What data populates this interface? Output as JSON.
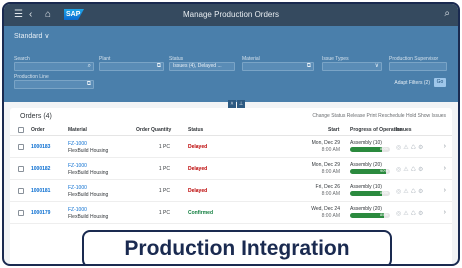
{
  "shell": {
    "title": "Manage Production Orders",
    "logo_text": "SAP"
  },
  "header": {
    "standard_label": "Standard ∨",
    "filters": [
      {
        "label": "Search",
        "value": ""
      },
      {
        "label": "Plant",
        "value": ""
      },
      {
        "label": "Status",
        "value": "Issues (4), Delayed ..."
      },
      {
        "label": "Material",
        "value": ""
      },
      {
        "label": "Issue Types",
        "value": ""
      },
      {
        "label": "Production Supervisor",
        "value": ""
      },
      {
        "label": "Production Line",
        "value": ""
      }
    ],
    "adapt_filters": "Adapt Filters (2)",
    "go": "Go"
  },
  "table": {
    "title": "Orders (4)",
    "toolbar_actions": "Change Status  Release  Print  Reschedule  Hold  Show Issues",
    "columns": [
      "Order",
      "Material",
      "Order Quantity",
      "Status",
      "Start",
      "Progress of Operation",
      "Issues"
    ],
    "rows": [
      {
        "order": "1000183",
        "material_id": "FZ-1000",
        "material_name": "FlexBuild Housing",
        "qty": "1 PC",
        "status": "Delayed",
        "status_color": "#bb0000",
        "start_date": "Mon, Dec 29",
        "start_time": "8:00 AM",
        "prog_label": "Assembly (10)",
        "prog": 0.8,
        "prog_pct": "80%"
      },
      {
        "order": "1000182",
        "material_id": "FZ-1000",
        "material_name": "FlexBuild Housing",
        "qty": "1 PC",
        "status": "Delayed",
        "status_color": "#bb0000",
        "start_date": "Mon, Dec 29",
        "start_time": "8:00 AM",
        "prog_label": "Assembly (20)",
        "prog": 0.9,
        "prog_pct": "90%"
      },
      {
        "order": "1000181",
        "material_id": "FZ-1000",
        "material_name": "FlexBuild Housing",
        "qty": "1 PC",
        "status": "Delayed",
        "status_color": "#bb0000",
        "start_date": "Fri, Dec 26",
        "start_time": "8:00 AM",
        "prog_label": "Assembly (10)",
        "prog": 0.8,
        "prog_pct": "80%"
      },
      {
        "order": "1000179",
        "material_id": "FZ-1000",
        "material_name": "FlexBuild Housing",
        "qty": "1 PC",
        "status": "Confirmed",
        "status_color": "#107e3e",
        "start_date": "Wed, Dec 24",
        "start_time": "8:00 AM",
        "prog_label": "Assembly (20)",
        "prog": 0.85,
        "prog_pct": "85%"
      }
    ]
  },
  "overlay": {
    "text": "Production Integration"
  },
  "colors": {
    "shell": "#354a5f",
    "header": "#4a7fab",
    "link": "#0a6ed1",
    "progress": "#2b8a3e",
    "overlay_border": "#1a2a50"
  }
}
